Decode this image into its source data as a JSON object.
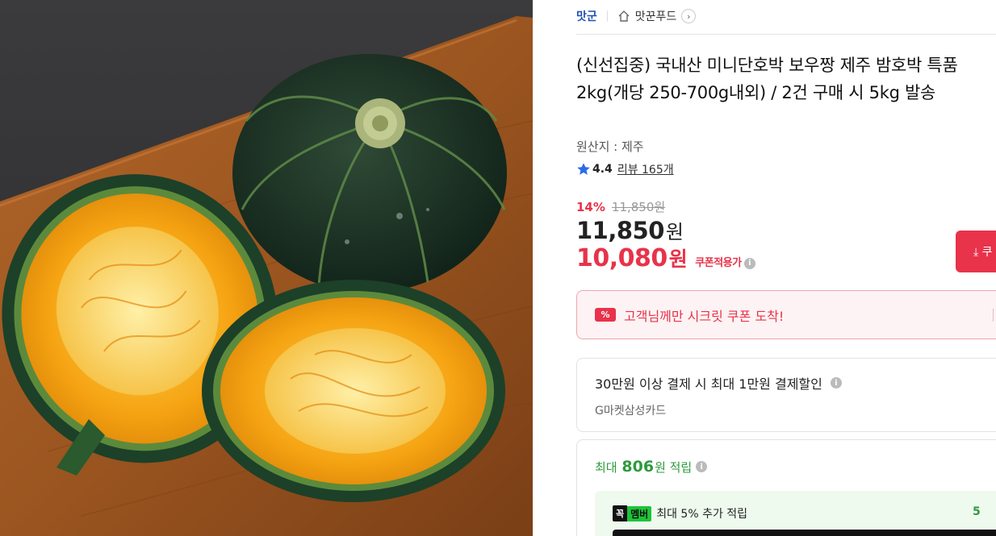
{
  "photo": {
    "alt_name": "kabocha-pumpkin-photo"
  },
  "topbar": {
    "seller": "맛군",
    "shop_name": "맛꾼푸드",
    "chevron": "›"
  },
  "product": {
    "title": "(신선집중) 국내산 미니단호박 보우짱 제주 밤호박 특품 2kg(개당 250-700g내외) / 2건 구매 시 5kg 발송",
    "origin": "원산지 : 제주",
    "rating_score": "4.4",
    "review_text": "리뷰 165개"
  },
  "pricing": {
    "discount_rate": "14%",
    "original_price": "11,850원",
    "price_number": "11,850",
    "price_unit": "원",
    "coupon_price_number": "10,080",
    "coupon_price_unit": "원",
    "coupon_label": "쿠폰적용가",
    "download_label": "⤓ 쿠"
  },
  "secret_coupon": {
    "icon": "%",
    "text": "고객님께만 시크릿 쿠폰 도착!"
  },
  "card_discount": {
    "title": "30만원 이상 결제 시 최대 1만원 결제할인",
    "card_name": "G마켓삼성카드"
  },
  "points": {
    "prefix": "최대",
    "amount": "806",
    "suffix": "원 적립",
    "member_badge_a": "꼭",
    "member_badge_b": "멤버",
    "member_text": "최대 5% 추가 적립",
    "member_right": "5"
  },
  "info_glyph": "i",
  "colors": {
    "accent_red": "#e8334a",
    "seller_blue": "#1f4fb5",
    "point_green": "#2e9a3c"
  }
}
